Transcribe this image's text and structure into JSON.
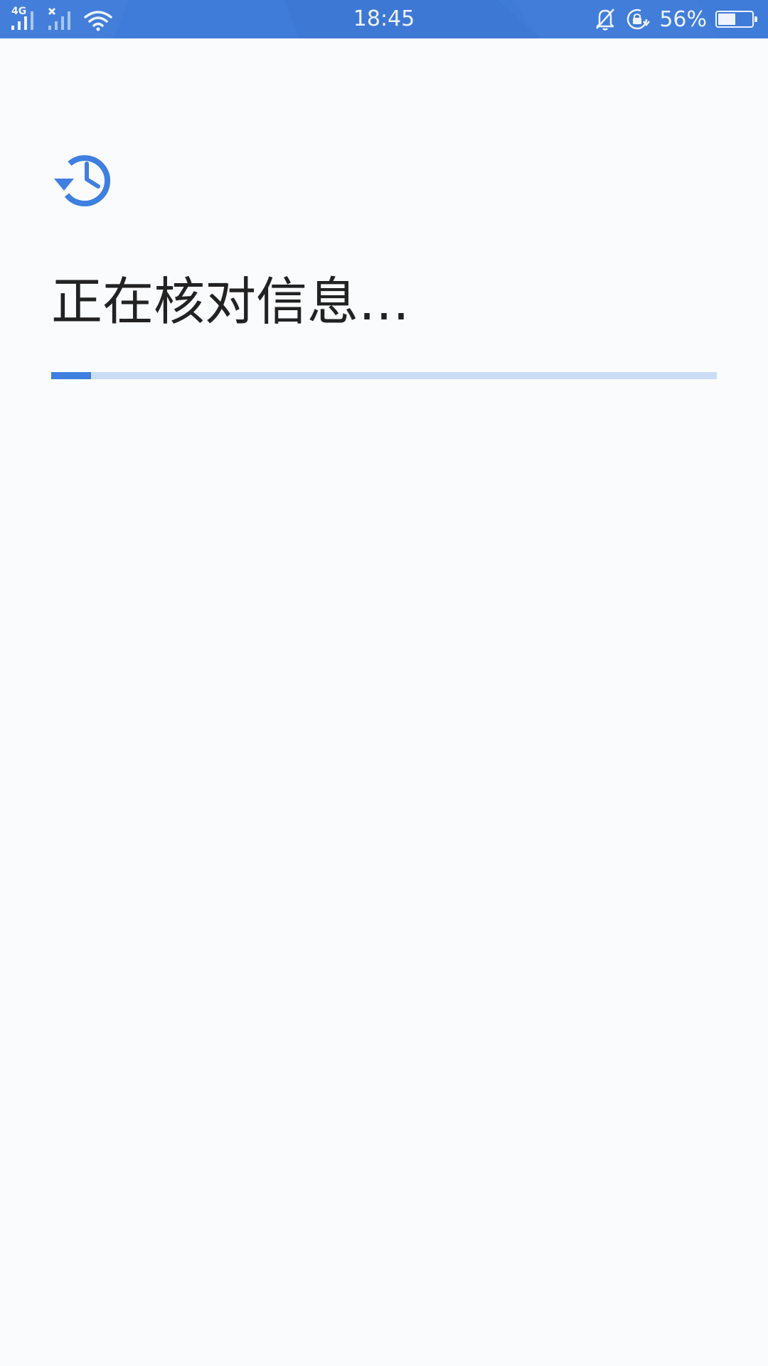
{
  "status_bar": {
    "network_label": "4G",
    "time": "18:45",
    "battery_percent_text": "56%",
    "battery_level": 0.56,
    "background_color": "#3f7bd8",
    "icons": [
      "signal-4g-icon",
      "signal-no-sim-icon",
      "wifi-icon",
      "bell-muted-icon",
      "rotation-lock-icon",
      "battery-icon"
    ]
  },
  "main": {
    "icon": "history-icon",
    "accent_color": "#3f7fe0",
    "title": "正在核对信息…",
    "progress": 0.06
  }
}
